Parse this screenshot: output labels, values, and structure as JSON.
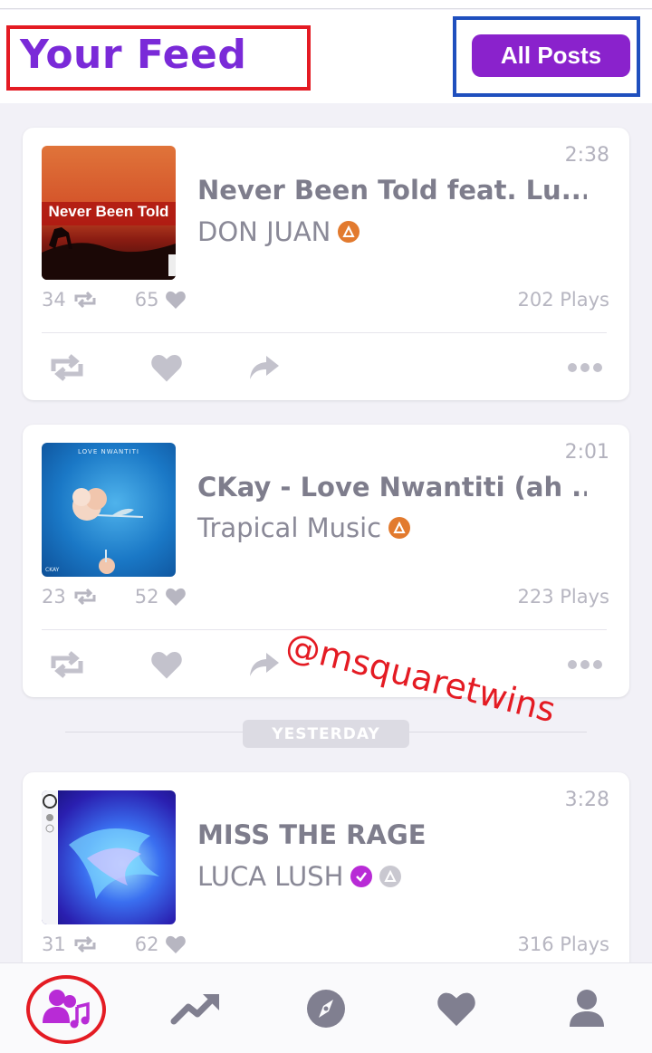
{
  "header": {
    "title": "Your Feed",
    "all_posts_label": "All Posts"
  },
  "feed": [
    {
      "duration": "2:38",
      "title": "Never Been Told feat. Lu...",
      "artist": "DON JUAN",
      "art_text": "Never Been Told",
      "reposts": "34",
      "likes": "65",
      "plays": "202 Plays"
    },
    {
      "duration": "2:01",
      "title": "CKay - Love Nwantiti (ah ...",
      "artist": "Trapical Music",
      "art_text_top": "LOVE NWANTITI",
      "art_text_bottom": "CKAY",
      "reposts": "23",
      "likes": "52",
      "plays": "223 Plays"
    },
    {
      "duration": "3:28",
      "title": "MISS THE RAGE",
      "artist": "LUCA LUSH",
      "reposts": "31",
      "likes": "62",
      "plays": "316 Plays"
    }
  ],
  "separator": {
    "label": "YESTERDAY"
  },
  "watermark": "@msquaretwins",
  "tabs": [
    {
      "icon": "feed-icon"
    },
    {
      "icon": "trending-icon"
    },
    {
      "icon": "explore-icon"
    },
    {
      "icon": "favorites-icon"
    },
    {
      "icon": "profile-icon"
    }
  ],
  "colors": {
    "accent": "#8a22cc",
    "annotation_red": "#e41b23",
    "annotation_blue": "#1f4fbe",
    "icon_gray": "#807f90"
  }
}
